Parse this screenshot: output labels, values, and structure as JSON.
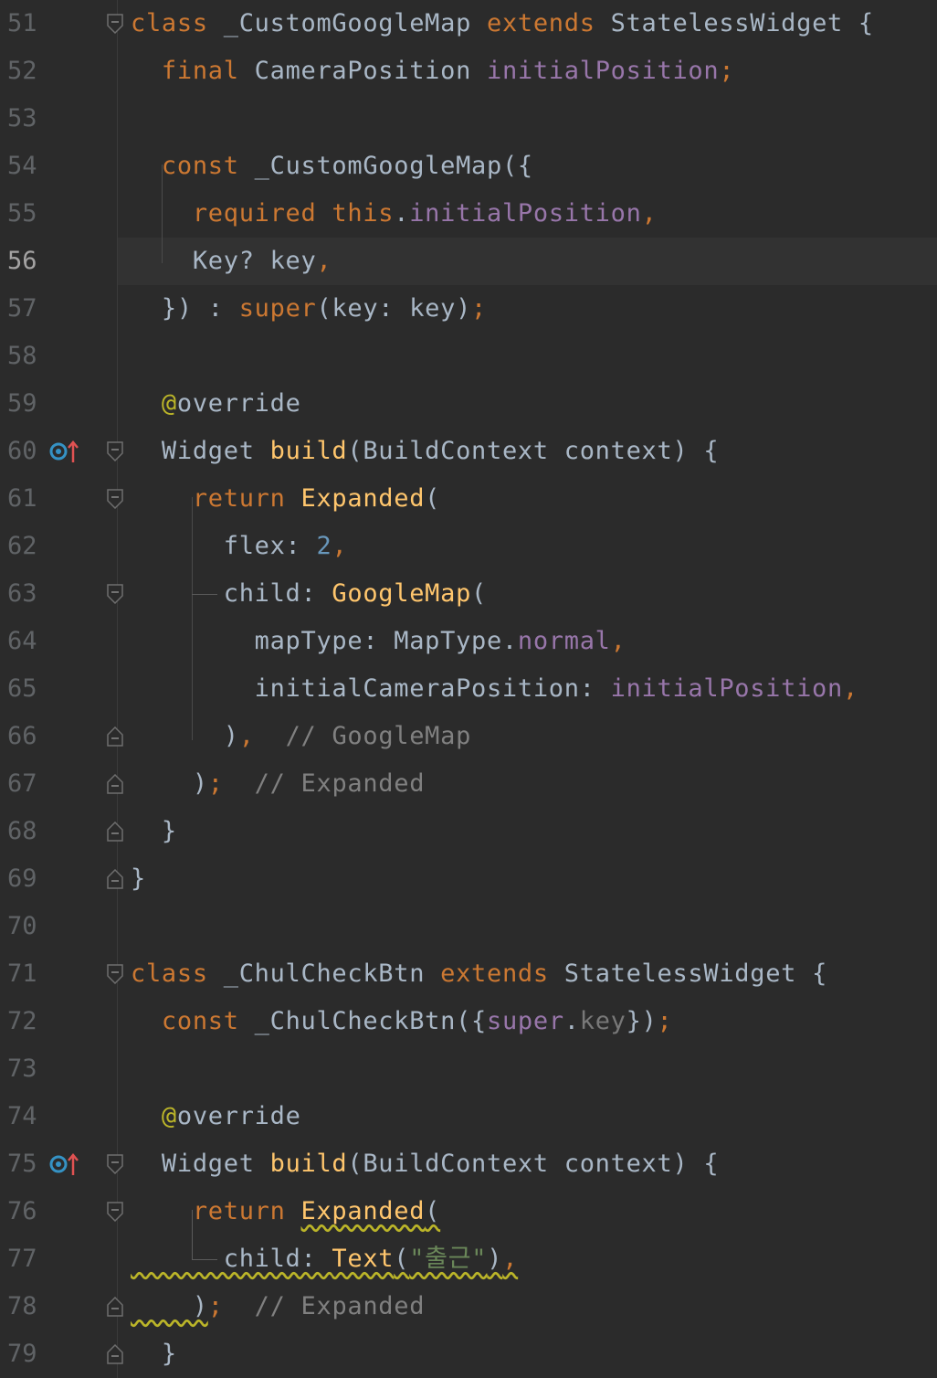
{
  "editor": {
    "current_line": 56,
    "lines": [
      {
        "num": "51",
        "fold": "open",
        "tokens": [
          [
            "class",
            "kw"
          ],
          [
            " _CustomGoogleMap ",
            "type"
          ],
          [
            "extends",
            "kw"
          ],
          [
            " StatelessWidget {",
            "type"
          ]
        ]
      },
      {
        "num": "52",
        "tokens": [
          [
            "  final ",
            "kw"
          ],
          [
            "CameraPosition ",
            "type"
          ],
          [
            "initialPosition",
            "field"
          ],
          [
            ";",
            "kw"
          ]
        ]
      },
      {
        "num": "53",
        "tokens": []
      },
      {
        "num": "54",
        "tokens": [
          [
            "  const ",
            "kw"
          ],
          [
            "_CustomGoogleMap({",
            "type"
          ]
        ]
      },
      {
        "num": "55",
        "tokens": [
          [
            "    required ",
            "kw"
          ],
          [
            "this",
            "kw"
          ],
          [
            ".",
            "id"
          ],
          [
            "initialPosition",
            "field"
          ],
          [
            ",",
            "kw"
          ]
        ]
      },
      {
        "num": "56",
        "tokens": [
          [
            "    Key? key",
            "id"
          ],
          [
            ",",
            "kw"
          ]
        ]
      },
      {
        "num": "57",
        "tokens": [
          [
            "  }) : ",
            "id"
          ],
          [
            "super",
            "kw"
          ],
          [
            "(key: key)",
            "id"
          ],
          [
            ";",
            "kw"
          ]
        ]
      },
      {
        "num": "58",
        "tokens": []
      },
      {
        "num": "59",
        "tokens": [
          [
            "  ",
            "id"
          ],
          [
            "@",
            "ann"
          ],
          [
            "override",
            "id"
          ]
        ]
      },
      {
        "num": "60",
        "fold": "open",
        "marker": "override-up-icon",
        "tokens": [
          [
            "  Widget ",
            "type"
          ],
          [
            "build",
            "fn"
          ],
          [
            "(BuildContext context) {",
            "id"
          ]
        ]
      },
      {
        "num": "61",
        "fold": "open",
        "tokens": [
          [
            "    return ",
            "kw"
          ],
          [
            "Expanded",
            "fn"
          ],
          [
            "(",
            "id"
          ]
        ]
      },
      {
        "num": "62",
        "tokens": [
          [
            "      flex: ",
            "id"
          ],
          [
            "2",
            "num"
          ],
          [
            ",",
            "kw"
          ]
        ]
      },
      {
        "num": "63",
        "fold": "open",
        "tokens": [
          [
            "      child: ",
            "id"
          ],
          [
            "GoogleMap",
            "fn"
          ],
          [
            "(",
            "id"
          ]
        ]
      },
      {
        "num": "64",
        "tokens": [
          [
            "        mapType: MapType.",
            "id"
          ],
          [
            "normal",
            "field"
          ],
          [
            ",",
            "kw"
          ]
        ]
      },
      {
        "num": "65",
        "tokens": [
          [
            "        initialCameraPosition: ",
            "id"
          ],
          [
            "initialPosition",
            "field"
          ],
          [
            ",",
            "kw"
          ]
        ]
      },
      {
        "num": "66",
        "fold": "close",
        "tokens": [
          [
            "      )",
            "id"
          ],
          [
            ",",
            "kw"
          ],
          [
            "  // GoogleMap",
            "com"
          ]
        ]
      },
      {
        "num": "67",
        "fold": "close",
        "tokens": [
          [
            "    )",
            "id"
          ],
          [
            ";",
            "kw"
          ],
          [
            "  // Expanded",
            "com"
          ]
        ]
      },
      {
        "num": "68",
        "fold": "close",
        "tokens": [
          [
            "  }",
            "id"
          ]
        ]
      },
      {
        "num": "69",
        "fold": "close",
        "tokens": [
          [
            "}",
            "id"
          ]
        ]
      },
      {
        "num": "70",
        "tokens": []
      },
      {
        "num": "71",
        "fold": "open",
        "tokens": [
          [
            "class",
            "kw"
          ],
          [
            " _ChulCheckBtn ",
            "type"
          ],
          [
            "extends",
            "kw"
          ],
          [
            " StatelessWidget {",
            "type"
          ]
        ]
      },
      {
        "num": "72",
        "tokens": [
          [
            "  const ",
            "kw"
          ],
          [
            "_ChulCheckBtn({",
            "type"
          ],
          [
            "super",
            "field"
          ],
          [
            ".",
            "id"
          ],
          [
            "key",
            "dim"
          ],
          [
            "})",
            "id"
          ],
          [
            ";",
            "kw"
          ]
        ]
      },
      {
        "num": "73",
        "tokens": []
      },
      {
        "num": "74",
        "tokens": [
          [
            "  ",
            "id"
          ],
          [
            "@",
            "ann"
          ],
          [
            "override",
            "id"
          ]
        ]
      },
      {
        "num": "75",
        "fold": "open",
        "marker": "override-up-icon",
        "tokens": [
          [
            "  Widget ",
            "type"
          ],
          [
            "build",
            "fn"
          ],
          [
            "(BuildContext context) {",
            "id"
          ]
        ]
      },
      {
        "num": "76",
        "fold": "open",
        "tokens": [
          [
            "    return ",
            "kw"
          ],
          [
            "Expanded",
            "fn",
            "wavy"
          ],
          [
            "(",
            "id",
            "wavy"
          ]
        ]
      },
      {
        "num": "77",
        "tokens": [
          [
            "      child: ",
            "id",
            "wavy"
          ],
          [
            "Text",
            "fn",
            "wavy"
          ],
          [
            "(",
            "id",
            "wavy"
          ],
          [
            "\"출근\"",
            "str",
            "wavy"
          ],
          [
            ")",
            "id",
            "wavy"
          ],
          [
            ",",
            "kw",
            "wavy"
          ]
        ]
      },
      {
        "num": "78",
        "fold": "close",
        "tokens": [
          [
            "    )",
            "id",
            "wavy"
          ],
          [
            ";",
            "kw"
          ],
          [
            "  // Expanded",
            "com"
          ]
        ]
      },
      {
        "num": "79",
        "fold": "close",
        "tokens": [
          [
            "  }",
            "id"
          ]
        ]
      }
    ]
  },
  "colors": {
    "background": "#2b2b2b",
    "keyword": "#cc7832",
    "field": "#9876aa",
    "function": "#ffc66d",
    "number": "#6897bb",
    "comment": "#808080",
    "string": "#6a8759",
    "annotation": "#bbb529",
    "text": "#a9b7c6",
    "line_number": "#606366",
    "current_line_bg": "#323232"
  }
}
